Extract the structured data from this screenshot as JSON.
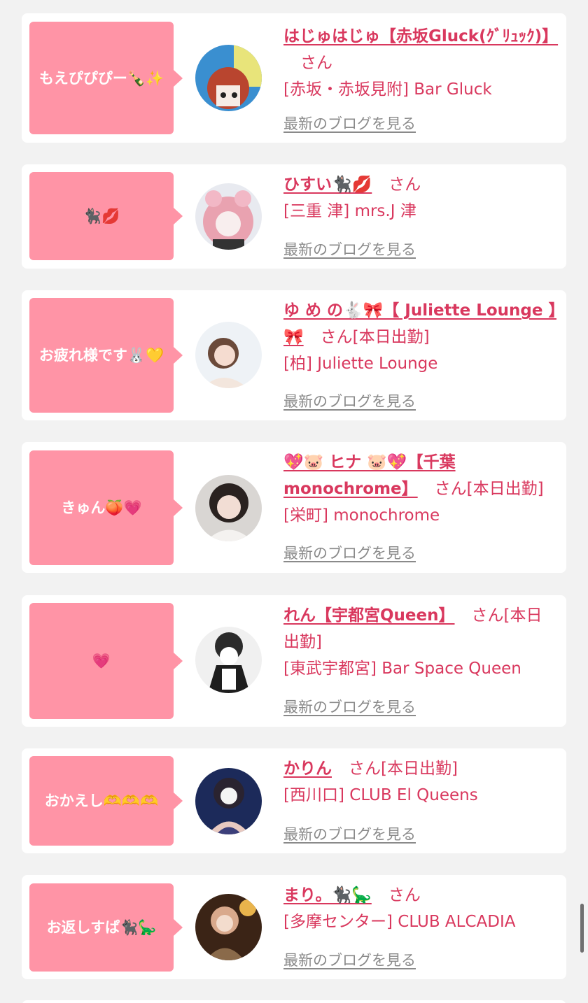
{
  "blog_link_label": "最新のブログを見る",
  "san_label": "さん",
  "cards": [
    {
      "bubble": "もえぴぴぴー🍾✨",
      "name": "はじゅはじゅ【赤坂Gluck(ｸﾞﾘｭｯｸ)】",
      "status": "",
      "shop": "[赤坂・赤坂見附] Bar Gluck"
    },
    {
      "bubble": "🐈‍⬛💋",
      "name": "ひすい🐈‍⬛💋",
      "status": "",
      "shop": "[三重 津] mrs.J 津"
    },
    {
      "bubble": "お疲れ様です🐰💛",
      "name": "ゆ め の🐇🎀【 Juliette Lounge 】🎀",
      "status": "[本日出勤]",
      "shop": "[柏] Juliette Lounge"
    },
    {
      "bubble": "きゅん🍑💗",
      "name": "💖🐷 ヒナ 🐷💖【千葉monochrome】",
      "status": "[本日出勤]",
      "shop": "[栄町] monochrome"
    },
    {
      "bubble": "💗",
      "name": "れん【宇都宮Queen】",
      "status": "[本日出勤]",
      "shop": "[東武宇都宮] Bar Space Queen"
    },
    {
      "bubble": "おかえし🫶🫶🫶",
      "name": "かりん",
      "status": "[本日出勤]",
      "shop": "[西川口] CLUB El Queens"
    },
    {
      "bubble": "お返しすぱ🐈‍⬛🦕",
      "name": "まり。🐈‍⬛🦕",
      "status": "",
      "shop": "[多摩センター] CLUB ALCADIA"
    }
  ],
  "colors": {
    "accent": "#d9385e",
    "bubble": "#ff94a6",
    "background": "#f2f2f2",
    "link_gray": "#8a8a8a"
  }
}
